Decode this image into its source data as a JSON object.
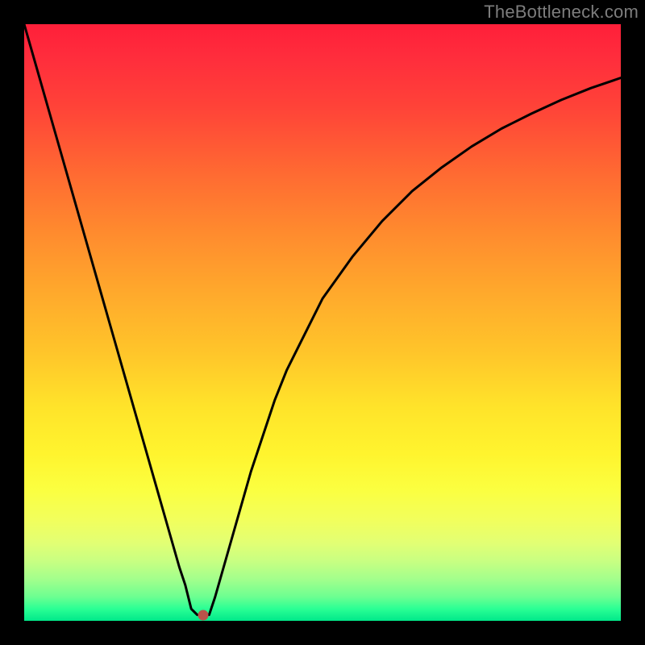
{
  "watermark": "TheBottleneck.com",
  "chart_data": {
    "type": "line",
    "title": "",
    "xlabel": "",
    "ylabel": "",
    "xlim": [
      0,
      100
    ],
    "ylim": [
      0,
      100
    ],
    "series": [
      {
        "name": "curve",
        "x": [
          0,
          2,
          4,
          6,
          8,
          10,
          12,
          14,
          16,
          18,
          20,
          22,
          24,
          26,
          27,
          28,
          29,
          30,
          31,
          32,
          34,
          36,
          38,
          40,
          42,
          44,
          46,
          50,
          55,
          60,
          65,
          70,
          75,
          80,
          85,
          90,
          95,
          100
        ],
        "values": [
          100,
          93,
          86,
          79,
          72,
          65,
          58,
          51,
          44,
          37,
          30,
          23,
          16,
          9,
          6,
          2,
          1,
          1,
          1,
          4,
          11,
          18,
          25,
          31,
          37,
          42,
          46,
          54,
          61,
          67,
          72,
          76,
          79.5,
          82.5,
          85,
          87.3,
          89.3,
          91
        ]
      }
    ],
    "marker": {
      "x": 30,
      "y": 1
    }
  },
  "colors": {
    "curve": "#000000",
    "marker": "#b9534a",
    "background_frame": "#000000"
  }
}
